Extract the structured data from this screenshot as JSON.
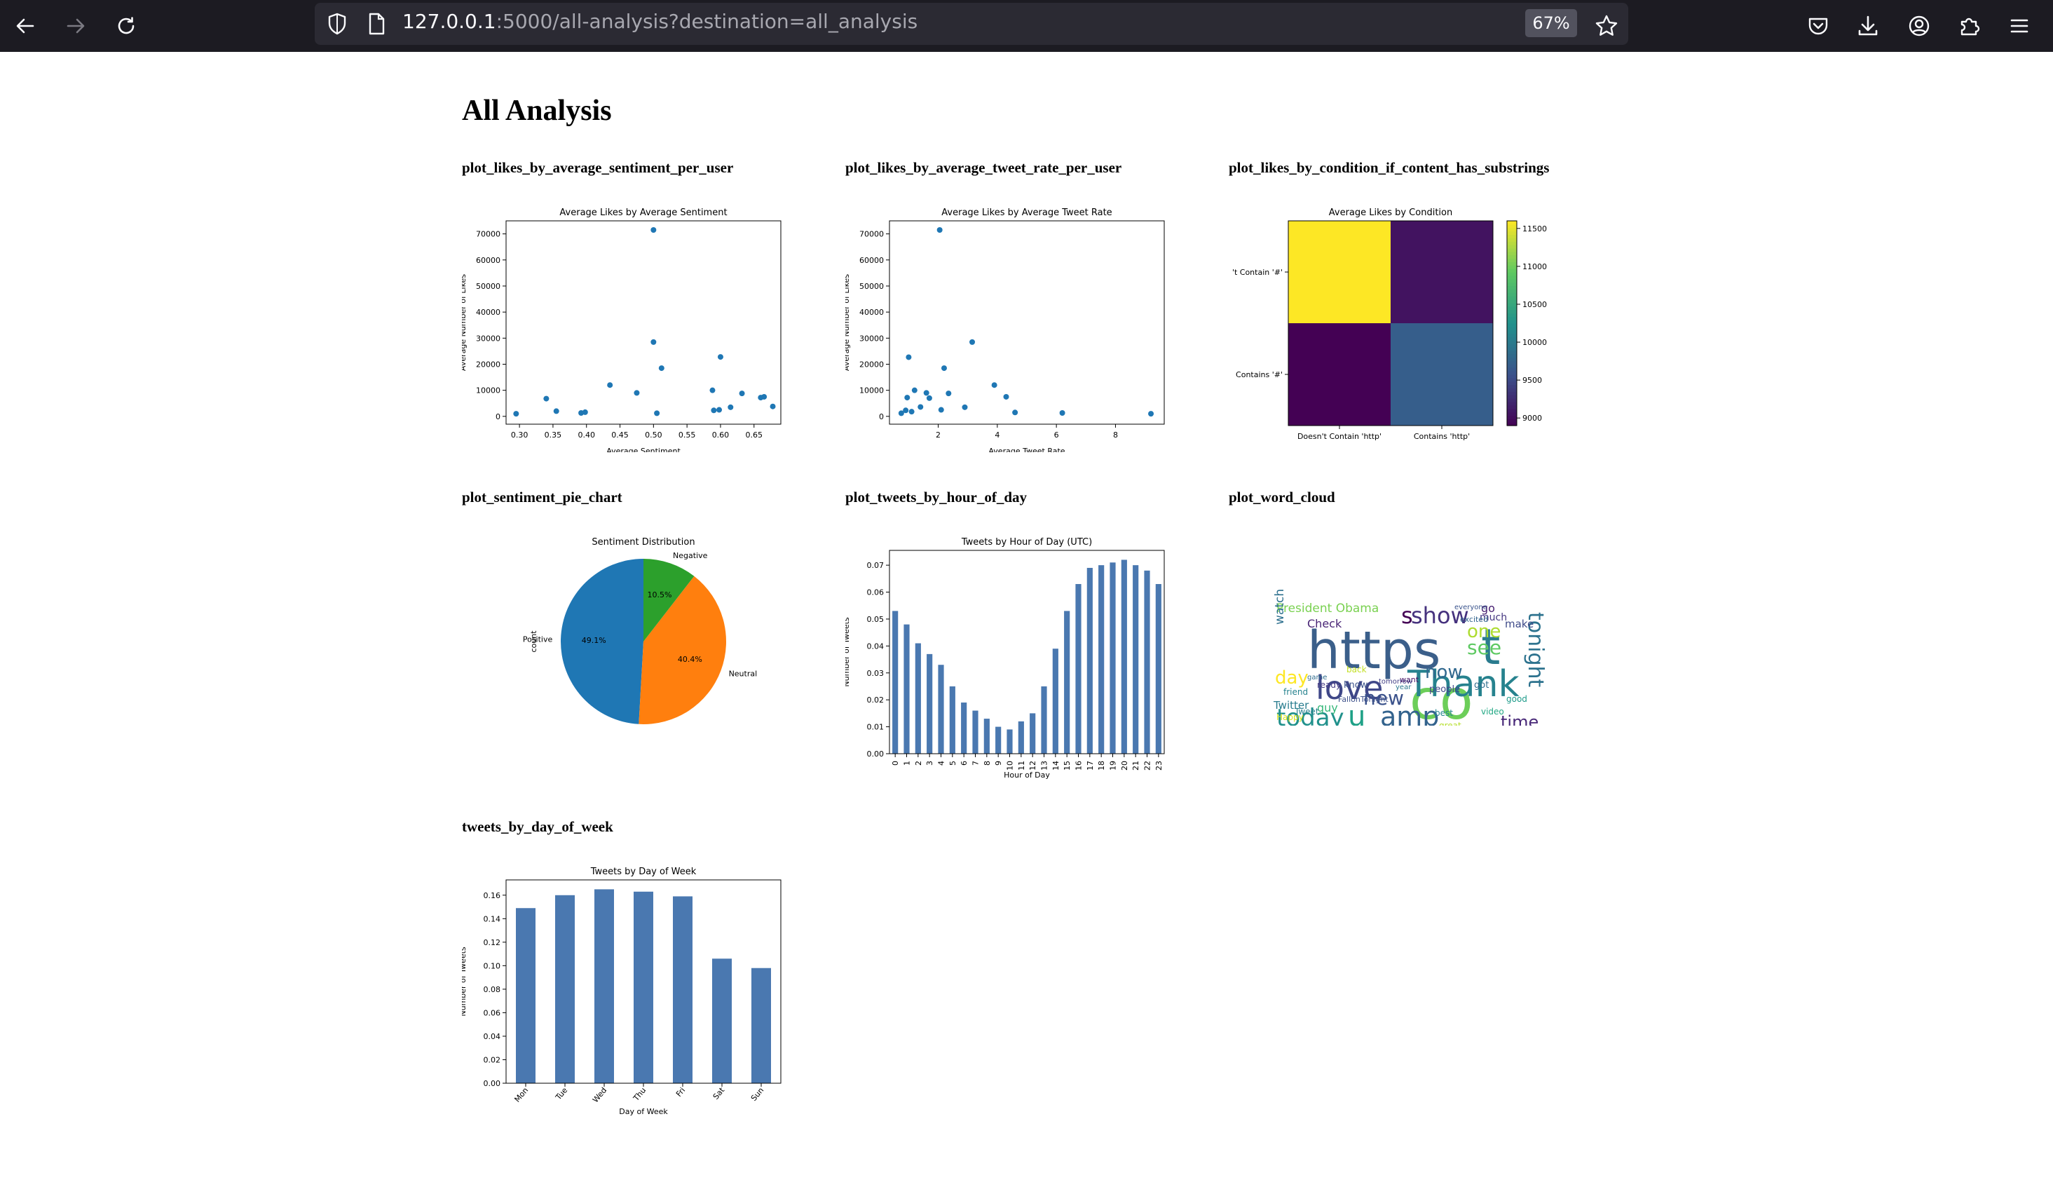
{
  "browser": {
    "url_host": "127.0.0.1",
    "url_rest": ":5000/all-analysis?destination=all_analysis",
    "zoom": "67%"
  },
  "page": {
    "title": "All Analysis",
    "sections": [
      {
        "title": "plot_likes_by_average_sentiment_per_user"
      },
      {
        "title": "plot_likes_by_average_tweet_rate_per_user"
      },
      {
        "title": "plot_likes_by_condition_if_content_has_substrings"
      },
      {
        "title": "plot_sentiment_pie_chart"
      },
      {
        "title": "plot_tweets_by_hour_of_day"
      },
      {
        "title": "plot_word_cloud"
      },
      {
        "title": "tweets_by_day_of_week"
      }
    ]
  },
  "chart_data": [
    {
      "type": "scatter",
      "title": "Average Likes by Average Sentiment",
      "xlabel": "Average Sentiment",
      "ylabel": "Average Number of Likes",
      "xlim": [
        0.28,
        0.69
      ],
      "ylim": [
        -3000,
        75000
      ],
      "xticks": [
        0.3,
        0.35,
        0.4,
        0.45,
        0.5,
        0.55,
        0.6,
        0.65
      ],
      "xtick_labels": [
        "0.30",
        "0.35",
        "0.40",
        "0.45",
        "0.50",
        "0.55",
        "0.60",
        "0.65"
      ],
      "yticks": [
        0,
        10000,
        20000,
        30000,
        40000,
        50000,
        60000,
        70000
      ],
      "ytick_labels": [
        "0",
        "10000",
        "20000",
        "30000",
        "40000",
        "50000",
        "60000",
        "70000"
      ],
      "color": "#1f77b4",
      "points": [
        [
          0.295,
          1000
        ],
        [
          0.34,
          6800
        ],
        [
          0.355,
          2000
        ],
        [
          0.392,
          1300
        ],
        [
          0.398,
          1600
        ],
        [
          0.435,
          12000
        ],
        [
          0.475,
          9000
        ],
        [
          0.5,
          71500
        ],
        [
          0.5,
          28500
        ],
        [
          0.505,
          1200
        ],
        [
          0.512,
          18500
        ],
        [
          0.588,
          10000
        ],
        [
          0.59,
          2300
        ],
        [
          0.598,
          2500
        ],
        [
          0.6,
          22800
        ],
        [
          0.615,
          3500
        ],
        [
          0.632,
          8800
        ],
        [
          0.66,
          7200
        ],
        [
          0.665,
          7500
        ],
        [
          0.678,
          3800
        ]
      ]
    },
    {
      "type": "scatter",
      "title": "Average Likes by Average Tweet Rate",
      "xlabel": "Average Tweet Rate",
      "ylabel": "Average Number of Likes",
      "xlim": [
        0.35,
        9.65
      ],
      "ylim": [
        -3000,
        75000
      ],
      "xticks": [
        2,
        4,
        6,
        8
      ],
      "xtick_labels": [
        "2",
        "4",
        "6",
        "8"
      ],
      "yticks": [
        0,
        10000,
        20000,
        30000,
        40000,
        50000,
        60000,
        70000
      ],
      "ytick_labels": [
        "0",
        "10000",
        "20000",
        "30000",
        "40000",
        "50000",
        "60000",
        "70000"
      ],
      "color": "#1f77b4",
      "points": [
        [
          0.75,
          1200
        ],
        [
          0.9,
          2300
        ],
        [
          0.95,
          7200
        ],
        [
          1.0,
          22700
        ],
        [
          1.1,
          1800
        ],
        [
          1.2,
          10000
        ],
        [
          1.4,
          3600
        ],
        [
          1.6,
          9000
        ],
        [
          1.7,
          7000
        ],
        [
          2.05,
          71500
        ],
        [
          2.1,
          2500
        ],
        [
          2.2,
          18500
        ],
        [
          2.35,
          8800
        ],
        [
          2.9,
          3500
        ],
        [
          3.15,
          28500
        ],
        [
          3.9,
          12000
        ],
        [
          4.3,
          7500
        ],
        [
          4.6,
          1500
        ],
        [
          6.2,
          1300
        ],
        [
          9.2,
          1000
        ]
      ]
    },
    {
      "type": "heatmap",
      "title": "Average Likes by Condition",
      "x_categories": [
        "Doesn't Contain 'http'",
        "Contains 'http'"
      ],
      "y_categories": [
        "Doesn't Contain '#'",
        "Contains '#'"
      ],
      "y_tick_labels_visible": [
        "'t Contain '#'",
        "Contains '#'"
      ],
      "values": [
        [
          11600,
          9050
        ],
        [
          8900,
          9700
        ]
      ],
      "colormap": "viridis",
      "vmin": 8900,
      "vmax": 11600,
      "colorbar_ticks": [
        9000,
        9500,
        10000,
        10500,
        11000,
        11500
      ],
      "colorbar_tick_labels": [
        "9000",
        "9500",
        "10000",
        "10500",
        "11000",
        "11500"
      ]
    },
    {
      "type": "pie",
      "title": "Sentiment Distribution",
      "ylabel": "count",
      "labels": [
        "Positive",
        "Neutral",
        "Negative"
      ],
      "values": [
        49.1,
        40.4,
        10.5
      ],
      "pct_labels": [
        "49.1%",
        "40.4%",
        "10.5%"
      ],
      "colors": [
        "#1f77b4",
        "#ff7f0e",
        "#2ca02c"
      ]
    },
    {
      "type": "bar",
      "title": "Tweets by Hour of Day (UTC)",
      "xlabel": "Hour of Day",
      "ylabel": "Number of Tweets",
      "categories": [
        "0",
        "1",
        "2",
        "3",
        "4",
        "5",
        "6",
        "7",
        "8",
        "9",
        "10",
        "11",
        "12",
        "13",
        "14",
        "15",
        "16",
        "17",
        "18",
        "19",
        "20",
        "21",
        "22",
        "23"
      ],
      "values": [
        0.053,
        0.048,
        0.041,
        0.037,
        0.033,
        0.025,
        0.019,
        0.016,
        0.013,
        0.01,
        0.009,
        0.012,
        0.015,
        0.025,
        0.039,
        0.053,
        0.063,
        0.069,
        0.07,
        0.071,
        0.072,
        0.07,
        0.068,
        0.063
      ],
      "ylim": [
        0,
        0.0755
      ],
      "yticks": [
        0,
        0.01,
        0.02,
        0.03,
        0.04,
        0.05,
        0.06,
        0.07
      ],
      "ytick_labels": [
        "0.00",
        "0.01",
        "0.02",
        "0.03",
        "0.04",
        "0.05",
        "0.06",
        "0.07"
      ],
      "color": "#4a78b0"
    },
    {
      "type": "bar",
      "title": "Tweets by Day of Week",
      "xlabel": "Day of Week",
      "ylabel": "Number of Tweets",
      "categories": [
        "Mon",
        "Tue",
        "Wed",
        "Thu",
        "Fri",
        "Sat",
        "Sun"
      ],
      "values": [
        0.149,
        0.16,
        0.165,
        0.163,
        0.159,
        0.106,
        0.098
      ],
      "ylim": [
        0,
        0.173
      ],
      "yticks": [
        0,
        0.02,
        0.04,
        0.06,
        0.08,
        0.1,
        0.12,
        0.14,
        0.16
      ],
      "ytick_labels": [
        "0.00",
        "0.02",
        "0.04",
        "0.06",
        "0.08",
        "0.10",
        "0.12",
        "0.14",
        "0.16"
      ],
      "color": "#4a78b0"
    }
  ],
  "word_cloud": {
    "words": [
      {
        "text": "https",
        "color": "#3b5f8a"
      },
      {
        "text": "t",
        "color": "#2a7b8e"
      },
      {
        "text": "co",
        "color": "#6cce59"
      },
      {
        "text": "Thank",
        "color": "#26828e"
      },
      {
        "text": "love",
        "color": "#3f4788"
      },
      {
        "text": "amp",
        "color": "#33638d"
      },
      {
        "text": "today",
        "color": "#21918c"
      },
      {
        "text": "show",
        "color": "#46327e"
      },
      {
        "text": "tonight",
        "color": "#2c728e"
      },
      {
        "text": "new",
        "color": "#3b528b"
      },
      {
        "text": "now",
        "color": "#31688e"
      },
      {
        "text": "see",
        "color": "#5ec962"
      },
      {
        "text": "one",
        "color": "#addc30"
      },
      {
        "text": "time",
        "color": "#482878"
      },
      {
        "text": "u",
        "color": "#1fa187"
      },
      {
        "text": "day",
        "color": "#fde725"
      },
      {
        "text": "s",
        "color": "#440154"
      },
      {
        "text": "President Obama",
        "color": "#7ad151"
      },
      {
        "text": "watch",
        "color": "#2d708e"
      },
      {
        "text": "Check",
        "color": "#482475"
      },
      {
        "text": "make",
        "color": "#3e4a89"
      },
      {
        "text": "much",
        "color": "#453781"
      },
      {
        "text": "guy",
        "color": "#35b779"
      },
      {
        "text": "Twitter",
        "color": "#287c8e"
      },
      {
        "text": "people",
        "color": "#404688"
      },
      {
        "text": "best",
        "color": "#24868e"
      },
      {
        "text": "great",
        "color": "#b5de2b"
      },
      {
        "text": "friend",
        "color": "#26828e"
      },
      {
        "text": "ready",
        "color": "#443983"
      },
      {
        "text": "know",
        "color": "#3b528b"
      },
      {
        "text": "got",
        "color": "#2e6e8e"
      },
      {
        "text": "good",
        "color": "#1e9b8a"
      },
      {
        "text": "live",
        "color": "#52c569"
      },
      {
        "text": "look",
        "color": "#8fd744"
      },
      {
        "text": "go",
        "color": "#482071"
      },
      {
        "text": "Happy",
        "color": "#d8e219"
      },
      {
        "text": "excited",
        "color": "#32648e"
      },
      {
        "text": "everyone",
        "color": "#3a548c"
      },
      {
        "text": "want",
        "color": "#471063"
      },
      {
        "text": "year",
        "color": "#2a788e"
      },
      {
        "text": "FallonTonight",
        "color": "#3c4f8a"
      },
      {
        "text": "video",
        "color": "#22a884"
      },
      {
        "text": "back",
        "color": "#c2df23"
      },
      {
        "text": "tomorrow",
        "color": "#423f85"
      },
      {
        "text": "Tweet",
        "color": "#27808e"
      },
      {
        "text": "game",
        "color": "#2f6c8e"
      }
    ]
  }
}
